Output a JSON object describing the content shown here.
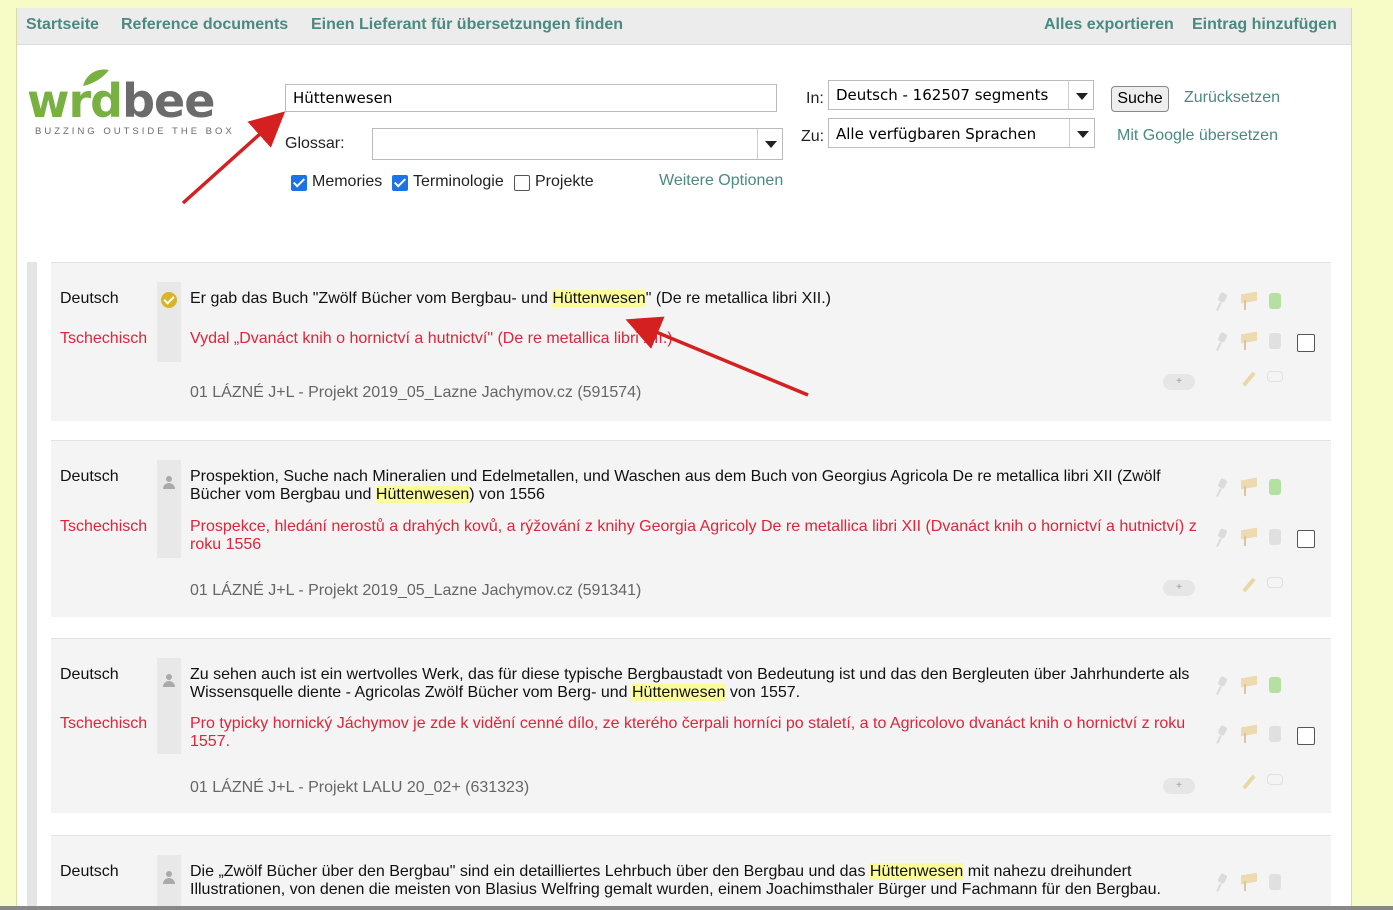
{
  "topnav": {
    "home": "Startseite",
    "reference": "Reference documents",
    "supplier": "Einen Lieferant für übersetzungen finden",
    "export_all": "Alles exportieren",
    "add_entry": "Eintrag hinzufügen"
  },
  "logo": {
    "word_w": "w",
    "word_rd": "rd",
    "word_bee": "bee",
    "tagline": "BUZZING OUTSIDE THE BOX"
  },
  "search": {
    "query": "Hüttenwesen",
    "glossary_label": "Glossar:",
    "glossary_value": "",
    "in_label": "In:",
    "in_value": "Deutsch - 162507 segments",
    "to_label": "Zu:",
    "to_value": "Alle verfügbaren Sprachen",
    "search_button": "Suche",
    "reset_link": "Zurücksetzen",
    "google_link": "Mit Google übersetzen",
    "more_options": "Weitere Optionen",
    "memories": {
      "label": "Memories",
      "checked": true
    },
    "terminology": {
      "label": "Terminologie",
      "checked": true
    },
    "projects": {
      "label": "Projekte",
      "checked": false
    }
  },
  "results": [
    {
      "src_lang": "Deutsch",
      "tgt_lang": "Tschechisch",
      "src_before": "Er gab das Buch \"Zwölf Bücher vom Bergbau- und ",
      "src_hl": "Hüttenwesen",
      "src_after": "\" (De re metallica libri XII.)",
      "tgt": "Vydal „Dvanáct knih o hornictví a hutnictví\" (De re metallica libri XII.)",
      "project": "01 LÁZNÉ J+L - Projekt 2019_05_Lazne Jachymov.cz (591574)",
      "approved": true
    },
    {
      "src_lang": "Deutsch",
      "tgt_lang": "Tschechisch",
      "src_before": "Prospektion, Suche nach Mineralien und Edelmetallen, und Waschen aus dem Buch von Georgius Agricola De re metallica libri XII (Zwölf Bücher vom Bergbau und ",
      "src_hl": "Hüttenwesen",
      "src_after": ") von 1556",
      "tgt": "Prospekce, hledání nerostů a drahých kovů, a rýžování z knihy Georgia Agricoly De re metallica libri XII (Dvanáct knih o hornictví a hutnictví) z roku 1556",
      "project": "01 LÁZNÉ J+L - Projekt 2019_05_Lazne Jachymov.cz (591341)",
      "approved": false
    },
    {
      "src_lang": "Deutsch",
      "tgt_lang": "Tschechisch",
      "src_before": "Zu sehen auch ist ein wertvolles Werk, das für diese typische Bergbaustadt von Bedeutung ist und das den Bergleuten über Jahrhunderte als Wissensquelle diente - Agricolas Zwölf Bücher vom Berg- und ",
      "src_hl": "Hüttenwesen",
      "src_after": " von 1557.",
      "tgt": "Pro typicky hornický Jáchymov je zde k vidění cenné dílo, ze kterého čerpali horníci po staletí, a to Agricolovo dvanáct knih o hornictví z roku 1557.",
      "project": "01 LÁZNÉ J+L - Projekt LALU 20_02+ (631323)",
      "approved": false
    },
    {
      "src_lang": "Deutsch",
      "tgt_lang": "",
      "src_before": "Die „Zwölf Bücher über den Bergbau\" sind ein detailliertes Lehrbuch über den Bergbau und das ",
      "src_hl": "Hüttenwesen",
      "src_after": " mit nahezu dreihundert Illustrationen, von denen die meisten von Blasius Welfring gemalt wurden, einem Joachimsthaler Bürger und Fachmann für den Bergbau.",
      "tgt": "",
      "project": "",
      "approved": false
    }
  ],
  "colors": {
    "accent": "#4a8a80",
    "target": "#e0243a",
    "highlight": "#fbfb9a",
    "background": "#f7fbc5"
  }
}
